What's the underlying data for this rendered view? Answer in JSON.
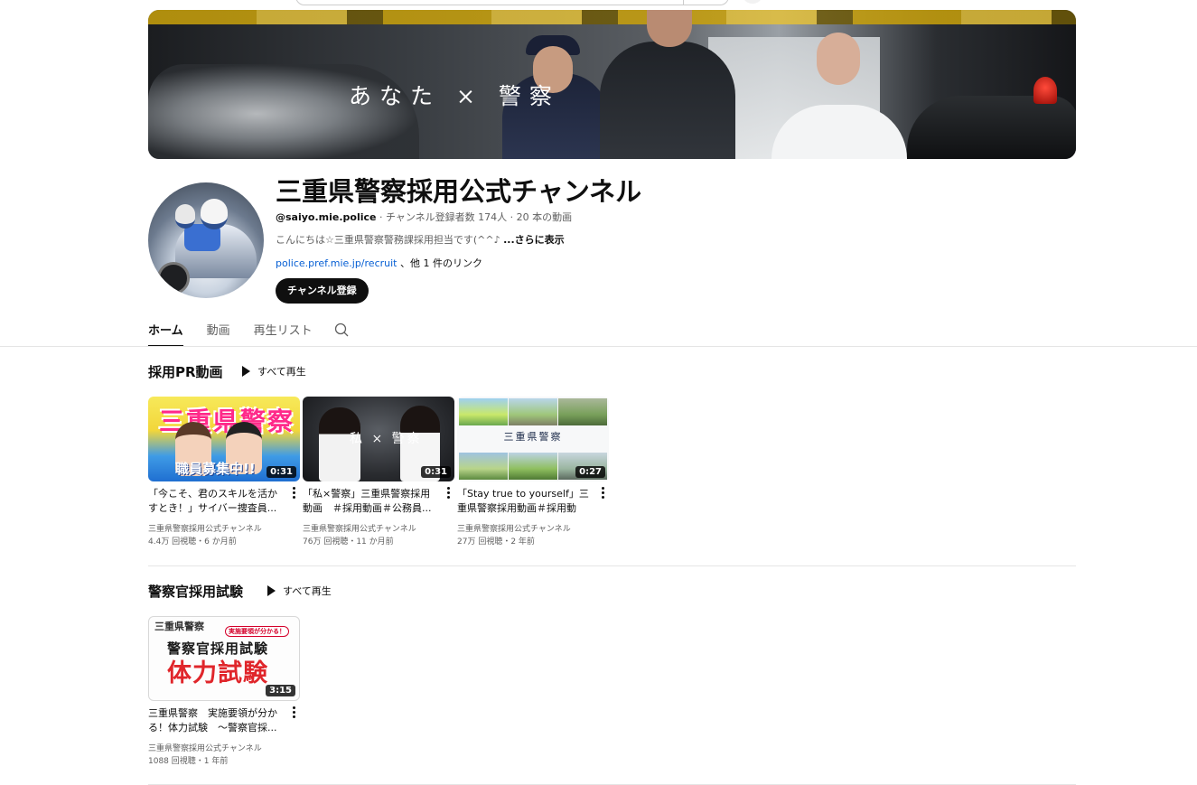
{
  "banner": {
    "title": "あなた × 警察"
  },
  "channel": {
    "name": "三重県警察採用公式チャンネル",
    "handle": "@saiyo.mie.police",
    "meta": " · チャンネル登録者数 174人 · 20 本の動画",
    "description": "こんにちは☆三重県警察警務課採用担当です(^^♪ ",
    "more_label": "...さらに表示",
    "link_url": "police.pref.mie.jp/recruit",
    "link_others": " 、他 1 件のリンク",
    "subscribe_label": "チャンネル登録"
  },
  "tabs": [
    "ホーム",
    "動画",
    "再生リスト"
  ],
  "sections": [
    {
      "title": "採用PR動画",
      "play_all": "すべて再生",
      "videos": [
        {
          "title": "「今こそ、君のスキルを活かすとき！」サイバー捜査員...",
          "duration": "0:31",
          "channel": "三重県警察採用公式チャンネル",
          "stats": "4.4万 回視聴・6 か月前",
          "thumb_text": "三重県警察",
          "thumb_sub": "職員募集中!!"
        },
        {
          "title": "「私×警察」三重県警察採用動画　＃採用動画＃公務員...",
          "duration": "0:31",
          "channel": "三重県警察採用公式チャンネル",
          "stats": "76万 回視聴・11 か月前",
          "thumb_text": "私 × 警察"
        },
        {
          "title": "「Stay true to yourself」三重県警察採用動画＃採用動画...",
          "duration": "0:27",
          "channel": "三重県警察採用公式チャンネル",
          "stats": "27万 回視聴・2 年前",
          "thumb_text": "三重県警察"
        }
      ]
    },
    {
      "title": "警察官採用試験",
      "play_all": "すべて再生",
      "videos": [
        {
          "title": "三重県警察　実施要領が分かる！体力試験　～警察官採...",
          "duration": "3:15",
          "channel": "三重県警察採用公式チャンネル",
          "stats": "1088 回視聴・1 年前",
          "thumb_text": "三重県警察",
          "thumb_badge": "実施要領が分かる！",
          "thumb_line2": "警察官採用試験",
          "thumb_line3": "体力試験"
        }
      ]
    }
  ]
}
